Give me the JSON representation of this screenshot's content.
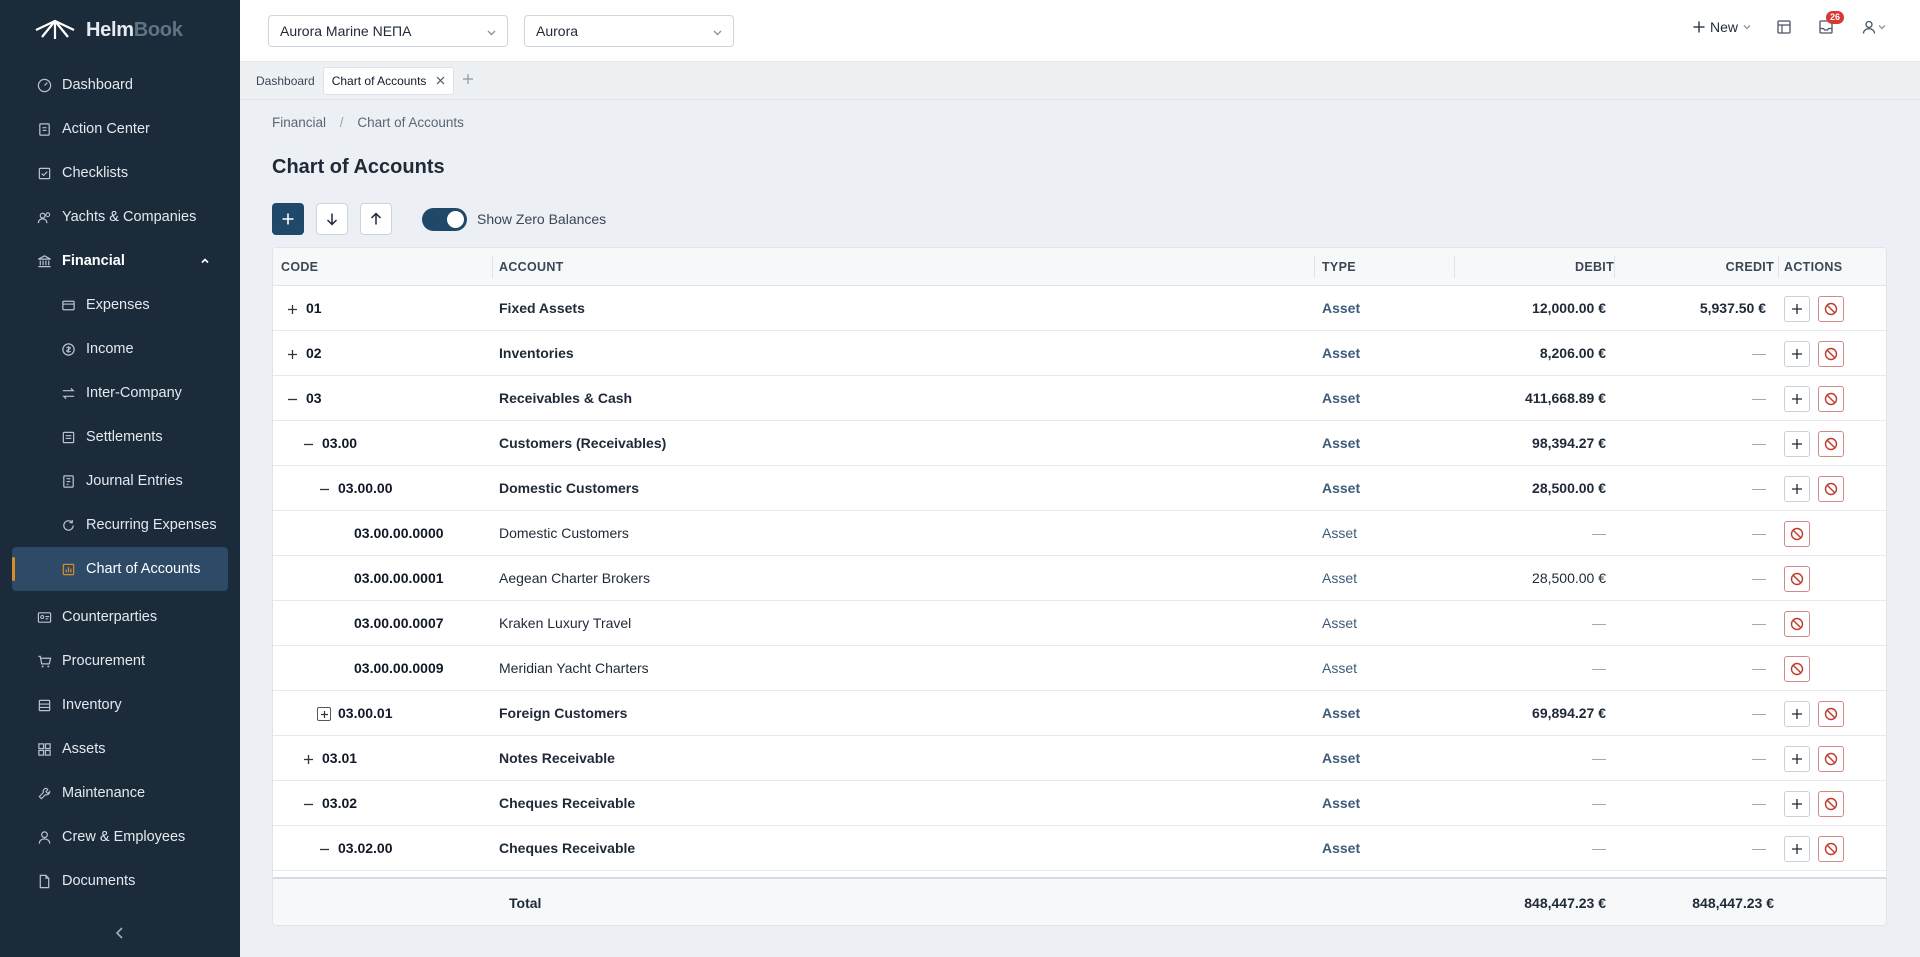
{
  "brand": {
    "part1": "Helm",
    "part2": "Book"
  },
  "sidebar": {
    "items": [
      {
        "label": "Dashboard",
        "icon": "gauge-icon"
      },
      {
        "label": "Action Center",
        "icon": "clipboard-icon"
      },
      {
        "label": "Checklists",
        "icon": "checkbox-icon"
      },
      {
        "label": "Yachts & Companies",
        "icon": "users-icon"
      },
      {
        "label": "Financial",
        "icon": "bank-icon"
      },
      {
        "label": "Expenses",
        "icon": "wallet-icon"
      },
      {
        "label": "Income",
        "icon": "coin-icon"
      },
      {
        "label": "Inter-Company",
        "icon": "transfer-icon"
      },
      {
        "label": "Settlements",
        "icon": "ledger-icon"
      },
      {
        "label": "Journal Entries",
        "icon": "journal-icon"
      },
      {
        "label": "Recurring Expenses",
        "icon": "refresh-icon"
      },
      {
        "label": "Chart of Accounts",
        "icon": "chart-icon"
      },
      {
        "label": "Counterparties",
        "icon": "id-card-icon"
      },
      {
        "label": "Procurement",
        "icon": "cart-icon"
      },
      {
        "label": "Inventory",
        "icon": "box-icon"
      },
      {
        "label": "Assets",
        "icon": "grid-icon"
      },
      {
        "label": "Maintenance",
        "icon": "wrench-icon"
      },
      {
        "label": "Crew & Employees",
        "icon": "person-icon"
      },
      {
        "label": "Documents",
        "icon": "document-icon"
      }
    ]
  },
  "topbar": {
    "company": "Aurora Marine ΝΕΠΑ",
    "vessel": "Aurora",
    "new_label": "New",
    "notification_count": "26"
  },
  "tabs": [
    {
      "label": "Dashboard"
    },
    {
      "label": "Chart of Accounts"
    }
  ],
  "breadcrumb": {
    "parent": "Financial",
    "sep": "/",
    "current": "Chart of Accounts"
  },
  "page_title": "Chart of Accounts",
  "toggle_label": "Show Zero Balances",
  "columns": {
    "code": "CODE",
    "account": "ACCOUNT",
    "type": "TYPE",
    "debit": "DEBIT",
    "credit": "CREDIT",
    "actions": "ACTIONS"
  },
  "rows": [
    {
      "code": "01",
      "account": "Fixed Assets",
      "type": "Asset",
      "debit": "12,000.00 €",
      "credit": "5,937.50 €"
    },
    {
      "code": "02",
      "account": "Inventories",
      "type": "Asset",
      "debit": "8,206.00 €",
      "credit": "—"
    },
    {
      "code": "03",
      "account": "Receivables & Cash",
      "type": "Asset",
      "debit": "411,668.89 €",
      "credit": "—"
    },
    {
      "code": "03.00",
      "account": "Customers (Receivables)",
      "type": "Asset",
      "debit": "98,394.27 €",
      "credit": "—"
    },
    {
      "code": "03.00.00",
      "account": "Domestic Customers",
      "type": "Asset",
      "debit": "28,500.00 €",
      "credit": "—"
    },
    {
      "code": "03.00.00.0000",
      "account": "Domestic Customers",
      "type": "Asset",
      "debit": "—",
      "credit": "—"
    },
    {
      "code": "03.00.00.0001",
      "account": "Aegean Charter Brokers",
      "type": "Asset",
      "debit": "28,500.00 €",
      "credit": "—"
    },
    {
      "code": "03.00.00.0007",
      "account": "Kraken Luxury Travel",
      "type": "Asset",
      "debit": "—",
      "credit": "—"
    },
    {
      "code": "03.00.00.0009",
      "account": "Meridian Yacht Charters",
      "type": "Asset",
      "debit": "—",
      "credit": "—"
    },
    {
      "code": "03.00.01",
      "account": "Foreign Customers",
      "type": "Asset",
      "debit": "69,894.27 €",
      "credit": "—"
    },
    {
      "code": "03.01",
      "account": "Notes Receivable",
      "type": "Asset",
      "debit": "—",
      "credit": "—"
    },
    {
      "code": "03.02",
      "account": "Cheques Receivable",
      "type": "Asset",
      "debit": "—",
      "credit": "—"
    },
    {
      "code": "03.02.00",
      "account": "Cheques Receivable",
      "type": "Asset",
      "debit": "—",
      "credit": "—"
    }
  ],
  "totals": {
    "label": "Total",
    "debit": "848,447.23 €",
    "credit": "848,447.23 €"
  }
}
